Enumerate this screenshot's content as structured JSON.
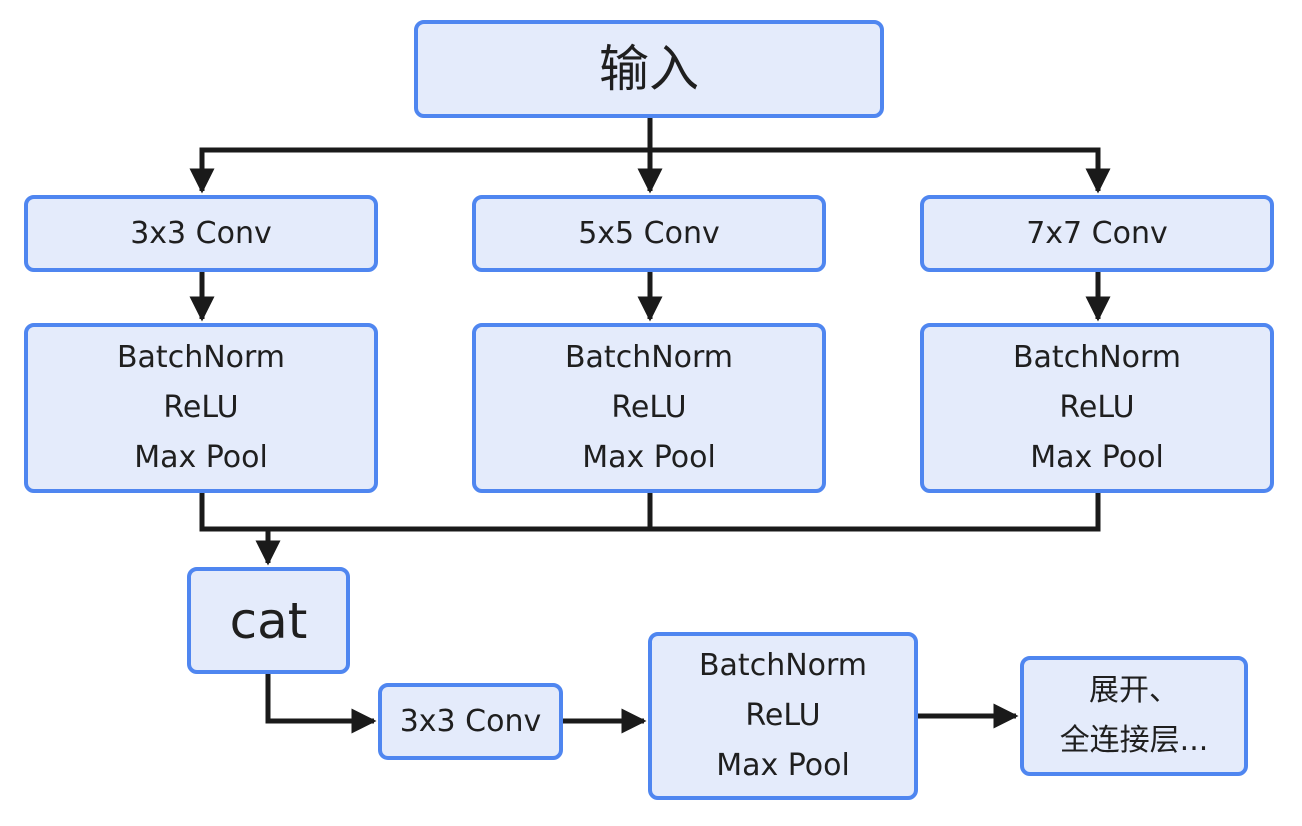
{
  "nodes": {
    "input": "输入",
    "conv3_top": "3x3 Conv",
    "conv5_top": "5x5 Conv",
    "conv7_top": "7x7 Conv",
    "bnr1": "BatchNorm\nReLU\nMax Pool",
    "bnr2": "BatchNorm\nReLU\nMax Pool",
    "bnr3": "BatchNorm\nReLU\nMax Pool",
    "cat": "cat",
    "conv3_bottom": "3x3 Conv",
    "bnr4": "BatchNorm\nReLU\nMax Pool",
    "flatten": "展开、\n全连接层..."
  },
  "colors": {
    "fill": "#e4ebfb",
    "border": "#4f86f0",
    "edge": "#1a1a1a"
  }
}
